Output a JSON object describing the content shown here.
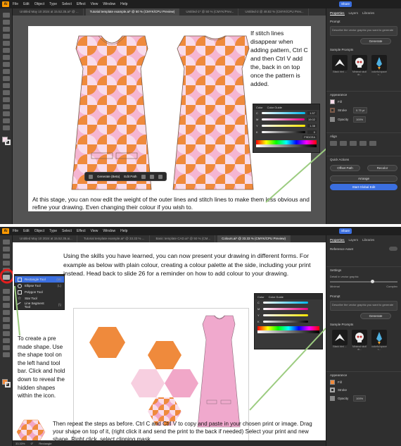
{
  "slide1": {
    "menu": [
      "File",
      "Edit",
      "Object",
      "Type",
      "Select",
      "Effect",
      "View",
      "Window",
      "Help"
    ],
    "tabs": [
      {
        "label": "Untitled May 10 2024 at 15.52.35.ai* @ ...",
        "active": false
      },
      {
        "label": "Tutorial template example.ai* @ 50 % (CMYK/CPU Preview)",
        "active": true
      },
      {
        "label": "Untitled-1* @ 50 % (CMYK/Prev...",
        "active": false
      },
      {
        "label": "Untitled-2 @ 48.82 % (CMYK/CPU Prev...",
        "active": false
      }
    ],
    "share_label": "Share",
    "right_panel": {
      "tabs": [
        "Properties",
        "Layers",
        "Libraries"
      ],
      "prompt_label": "Prompt",
      "prompt_placeholder": "Describe the vector graphic you want to generate",
      "generate_label": "Generate",
      "sample_prompts_label": "Sample Prompts",
      "samples": [
        "Black bird ...",
        "Minimal skull dr...",
        "colorful space r..."
      ],
      "appearance_label": "Appearance",
      "fill_label": "Fill",
      "stroke_label": "Stroke",
      "stroke_value": "0.75 pt",
      "opacity_label": "Opacity",
      "opacity_value": "100%",
      "align_label": "Align",
      "quick_actions_label": "Quick Actions",
      "offset_path_label": "Offset Path",
      "recolor_label": "Recolor",
      "arrange_label": "Arrange",
      "start_global_edit_label": "Start Global Edit"
    },
    "color_panel": {
      "tabs": [
        "Color",
        "Color Guide"
      ],
      "channels": [
        {
          "ch": "C",
          "value": "1.57",
          "color": "#00b7eb"
        },
        {
          "ch": "M",
          "value": "19.02",
          "color": "#e6007e"
        },
        {
          "ch": "Y",
          "value": "1.38",
          "color": "#ffe600"
        },
        {
          "ch": "K",
          "value": "0",
          "color": "#000000"
        }
      ],
      "hex": "F9DCEA"
    },
    "floating_bar": {
      "generate_label": "Generate (Beta)",
      "edit_path_label": "Edit Path"
    },
    "note": "If stitch lines disappear when adding pattern, Ctrl C and then Ctrl V add the, back in on top once the pattern is added.",
    "caption": "At this stage, you can now edit the weight of the outer lines and stitch lines to make them less obvious and refine your drawing. Even changing their colour if you wish to.",
    "colors": {
      "orange": "#ef8a3c",
      "pink": "#f5b6d2",
      "light_pink": "#f9dcea",
      "accent": "#9ccc80"
    }
  },
  "slide2": {
    "menu": [
      "File",
      "Edit",
      "Object",
      "Type",
      "Select",
      "Effect",
      "View",
      "Window",
      "Help"
    ],
    "tabs": [
      {
        "label": "Untitled May 10 2024 at 15.52.35.ai...",
        "active": false
      },
      {
        "label": "Tutorial template example.ai* @ 33.33 % ...",
        "active": false
      },
      {
        "label": "Basic template CAD.ai* @ 50 % (CM...",
        "active": false
      },
      {
        "label": "Colours.ai* @ 33.33 % (CMYK/CPU Preview)",
        "active": true
      }
    ],
    "share_label": "Share",
    "flyout": [
      {
        "label": "Rectangle Tool",
        "key": "(M)",
        "selected": true
      },
      {
        "label": "Ellipse Tool",
        "key": "(L)",
        "selected": false
      },
      {
        "label": "Polygon Tool",
        "key": "",
        "selected": false
      },
      {
        "label": "Star Tool",
        "key": "",
        "selected": false
      },
      {
        "label": "Line Segment Tool",
        "key": "(\\)",
        "selected": false
      }
    ],
    "color_panel": {
      "tabs": [
        "Color",
        "Color Guide"
      ],
      "channels": [
        {
          "ch": "C",
          "value": "",
          "color": "#00b7eb"
        },
        {
          "ch": "M",
          "value": "",
          "color": "#e6007e"
        },
        {
          "ch": "Y",
          "value": "",
          "color": "#ffe600"
        },
        {
          "ch": "K",
          "value": "",
          "color": "#000000"
        }
      ]
    },
    "right_panel": {
      "tabs": [
        "Properties",
        "Layers",
        "Libraries"
      ],
      "reference_asset_label": "Reference Asset",
      "settings_label": "Settings",
      "detail_label": "Detail in vector graphic",
      "minimal_label": "Minimal",
      "complex_label": "Complex",
      "prompt_label": "Prompt",
      "prompt_placeholder": "Describe the vector graphic you want to generate",
      "generate_label": "Generate",
      "sample_prompts_label": "Sample Prompts",
      "samples": [
        "Black bird ...",
        "Minimal skull dr...",
        "colorful space r..."
      ],
      "appearance_label": "Appearance",
      "fill_label": "Fill",
      "stroke_label": "Stroke",
      "opacity_label": "Opacity",
      "opacity_value": "100%"
    },
    "status": {
      "zoom": "33.33%",
      "angle": "0°",
      "tool": "Rectangle"
    },
    "top_text": "Using the skills you have learned, you can now present your drawing in different forms. For example as below with plain colour, creating a colour palette at the side, including your print instead. Head back to slide 26 for a reminder on how to add colour to your drawing.",
    "left_text": "To create a pre made shape. Use the shape tool on the left hand tool bar. Click and hold down to reveal the hidden shapes within the icon.",
    "bottom_text": "Then repeat the steps as before. Ctrl C and Ctrl V to copy and paste in your chosen print or image. Drag your shape on top of it, (right click it and send the print to the back if needed) Select your print and new shape. Right click, select clipping mask",
    "colors": {
      "orange": "#ef8a3c",
      "pink": "#f1a7c8",
      "light_pink": "#f7cfe0",
      "dress": "#f0a9cd",
      "highlight_ring": "#e41e1e",
      "accent": "#9ccc80"
    }
  }
}
